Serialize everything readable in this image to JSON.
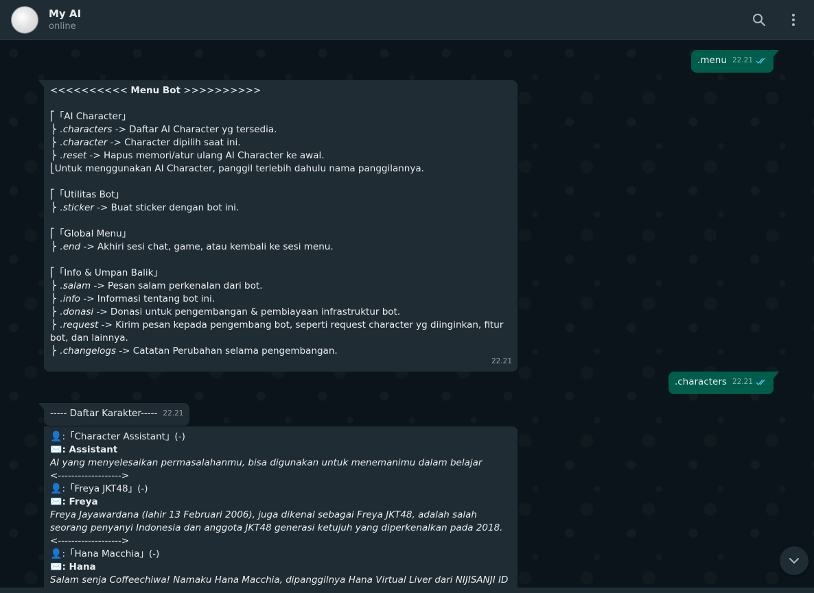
{
  "header": {
    "title": "My AI",
    "status": "online",
    "icons": [
      "search-icon",
      "menu-dots-icon"
    ]
  },
  "messages": {
    "m1": {
      "text": ".menu",
      "time": "22.21"
    },
    "m2": {
      "title_pre": "<<<<<<<<<< ",
      "title": "Menu Bot",
      "title_post": " >>>>>>>>>>",
      "sections": [
        {
          "header": "⎡「AI Character」",
          "items": [
            {
              "prefix": "⎬ ",
              "cmd": ".characters",
              "desc": " -> Daftar AI Character yg tersedia."
            },
            {
              "prefix": "⎬ ",
              "cmd": ".character",
              "desc": " -> Character dipilih saat ini."
            },
            {
              "prefix": "⎬ ",
              "cmd": ".reset",
              "desc": " -> Hapus memori/atur ulang AI Character ke awal."
            }
          ],
          "footer": "⎣Untuk menggunakan AI Character, panggil terlebih dahulu nama panggilannya."
        },
        {
          "header": "⎡「Utilitas Bot」",
          "items": [
            {
              "prefix": "⎬ ",
              "cmd": ".sticker",
              "desc": " -> Buat sticker dengan bot ini."
            }
          ]
        },
        {
          "header": "⎡「Global Menu」",
          "items": [
            {
              "prefix": "⎬ ",
              "cmd": ".end",
              "desc": " -> Akhiri sesi chat, game, atau kembali ke sesi menu."
            }
          ]
        },
        {
          "header": "⎡「Info & Umpan Balik」",
          "items": [
            {
              "prefix": "⎬ ",
              "cmd": ".salam",
              "desc": " -> Pesan salam perkenalan dari bot."
            },
            {
              "prefix": "⎬ ",
              "cmd": ".info",
              "desc": " -> Informasi tentang bot ini."
            },
            {
              "prefix": "⎬ ",
              "cmd": ".donasi",
              "desc": " -> Donasi untuk pengembangan & pembiayaan infrastruktur bot."
            },
            {
              "prefix": "⎬ ",
              "cmd": ".request",
              "desc": " -> Kirim pesan kepada pengembang bot, seperti request character yg diinginkan, fitur bot, dan lainnya."
            },
            {
              "prefix": "⎬ ",
              "cmd": ".changelogs",
              "desc": " -> Catatan Perubahan selama pengembangan."
            }
          ]
        }
      ],
      "time": "22.21"
    },
    "m3": {
      "text": ".characters",
      "time": "22.21"
    },
    "m4": {
      "text": "----- Daftar Karakter-----",
      "time": "22.21"
    },
    "m5": {
      "characters": [
        {
          "person_emoji": "👤",
          "name_line": ":「Character Assistant」(-)",
          "mail_emoji": "✉️",
          "nick": ": Assistant",
          "desc": "AI yang menyelesaikan permasalahanmu, bisa digunakan untuk menemanimu dalam belajar",
          "sep": "<------------------->"
        },
        {
          "person_emoji": "👤",
          "name_line": ":「Freya JKT48」(-)",
          "mail_emoji": "✉️",
          "nick": ": Freya",
          "desc": "Freya Jayawardana (lahir 13 Februari 2006), juga dikenal sebagai Freya JKT48, adalah salah seorang penyanyi Indonesia dan anggota JKT48 generasi ketujuh yang diperkenalkan pada 2018.",
          "sep": "<------------------->"
        },
        {
          "person_emoji": "👤",
          "name_line": ":「Hana Macchia」(-)",
          "mail_emoji": "✉️",
          "nick": ": Hana",
          "desc": "Salam senja Coffeechiwa! Namaku Hana Macchia, dipanggilnya Hana Virtual Liver dari NIJISANJI ID"
        }
      ]
    }
  },
  "colors": {
    "outgoing": "#005c4b",
    "incoming": "#202c33",
    "header": "#202c33",
    "read_ticks": "#53bdeb"
  }
}
